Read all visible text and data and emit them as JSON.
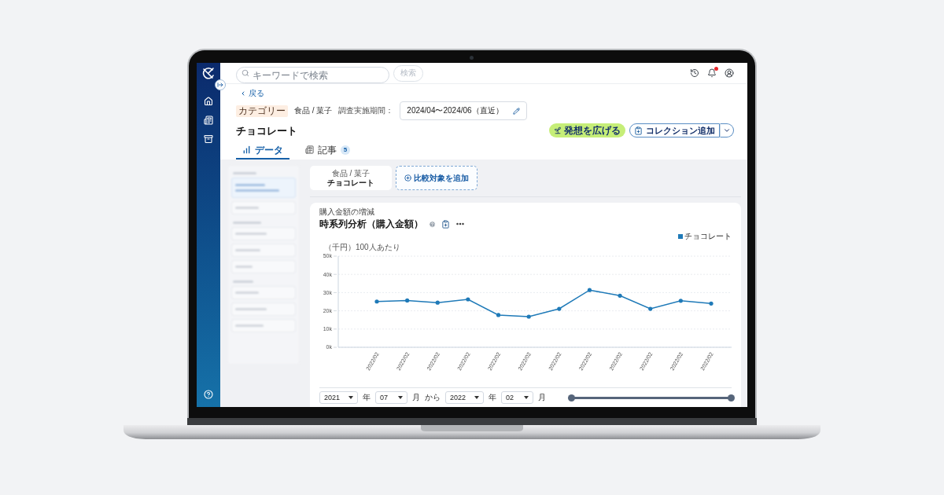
{
  "header": {
    "search": {
      "placeholder": "キーワードで検索"
    },
    "search_button": {
      "label": "検索",
      "disabled": true
    },
    "notifications": {
      "unread": true
    }
  },
  "back_link": {
    "label": "戻る"
  },
  "meta": {
    "badge": "カテゴリー",
    "category": "食品 / 菓子",
    "period_label": "調査実施期間：",
    "period_value": "2024/04〜2024/06（直近）"
  },
  "title": "チョコレート",
  "actions": [
    {
      "kind": "highlight",
      "label": "発想を広げる"
    },
    {
      "kind": "split",
      "label": "コレクション追加"
    }
  ],
  "tabs": [
    {
      "kind": "data",
      "label": "データ",
      "selected": true
    },
    {
      "kind": "articles",
      "label": "記事",
      "selected": false,
      "count": "5"
    }
  ],
  "comparison": {
    "items": [
      {
        "category": "食品 / 菓子",
        "name": "チョコレート"
      }
    ],
    "add_button": {
      "label": "比較対象を追加"
    }
  },
  "chart_card": {
    "subtitle": "購入金額の増減",
    "title": "時系列分析（購入金額）",
    "chart_data": {
      "type": "line",
      "ylabel": "（千円）100人あたり",
      "categories": [
        "2022/02",
        "2022/02",
        "2022/02",
        "2022/02",
        "2022/02",
        "2022/02",
        "2022/02",
        "2022/02",
        "2022/02",
        "2022/02",
        "2022/02",
        "2022/02"
      ],
      "series": [
        {
          "name": "チョコレート",
          "color": "#1f7ab8",
          "values": [
            25100,
            25700,
            24500,
            26300,
            17700,
            16800,
            21100,
            31400,
            28300,
            21100,
            25500,
            24000
          ]
        }
      ],
      "ylim": [
        0,
        50000
      ],
      "yticks": [
        {
          "value": 0,
          "label": "0k"
        },
        {
          "value": 10000,
          "label": "10k"
        },
        {
          "value": 20000,
          "label": "20k"
        },
        {
          "value": 30000,
          "label": "30k"
        },
        {
          "value": 40000,
          "label": "40k"
        },
        {
          "value": 50000,
          "label": "50k"
        }
      ],
      "grid": true
    },
    "period": {
      "fields": [
        {
          "kind": "select",
          "value": "2021"
        },
        {
          "kind": "label",
          "text": "年"
        },
        {
          "kind": "select",
          "value": "07"
        },
        {
          "kind": "label",
          "text": "月"
        },
        {
          "kind": "label",
          "text": "から"
        },
        {
          "kind": "select",
          "value": "2022"
        },
        {
          "kind": "label",
          "text": "年"
        },
        {
          "kind": "select",
          "value": "02"
        },
        {
          "kind": "label",
          "text": "月"
        }
      ],
      "range": {
        "level": 1
      }
    }
  }
}
